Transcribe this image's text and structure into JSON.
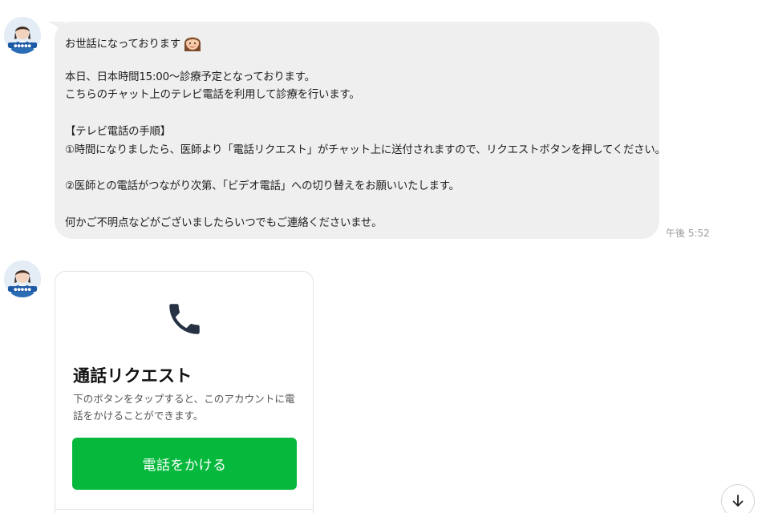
{
  "messages": [
    {
      "type": "text",
      "lines": [
        "お世話になっております",
        "",
        "本日、日本時間15:00〜診療予定となっております。",
        "こちらのチャット上のテレビ電話を利用して診療を行います。",
        "",
        "【テレビ電話の手順】",
        "①時間になりましたら、医師より「電話リクエスト」がチャット上に送付されますので、リクエストボタンを押してください。",
        "",
        "②医師との電話がつながり次第、「ビデオ電話」への切り替えをお願いいたします。",
        "",
        "何かご不明点などがございましたらいつでもご連絡くださいませ。"
      ],
      "emoji": "woman-face-icon",
      "time": "午後 5:52"
    },
    {
      "type": "call_request_card",
      "icon": "phone-icon",
      "title": "通話リクエスト",
      "description": "下のボタンをタップすると、このアカウントに電話をかけることができます。",
      "button_label": "電話をかける"
    }
  ],
  "colors": {
    "bubble_bg": "#efefef",
    "button_green": "#06b93d",
    "phone_icon": "#263244",
    "timestamp": "#9a9a9a"
  },
  "scroll_button_icon": "arrow-down-icon"
}
